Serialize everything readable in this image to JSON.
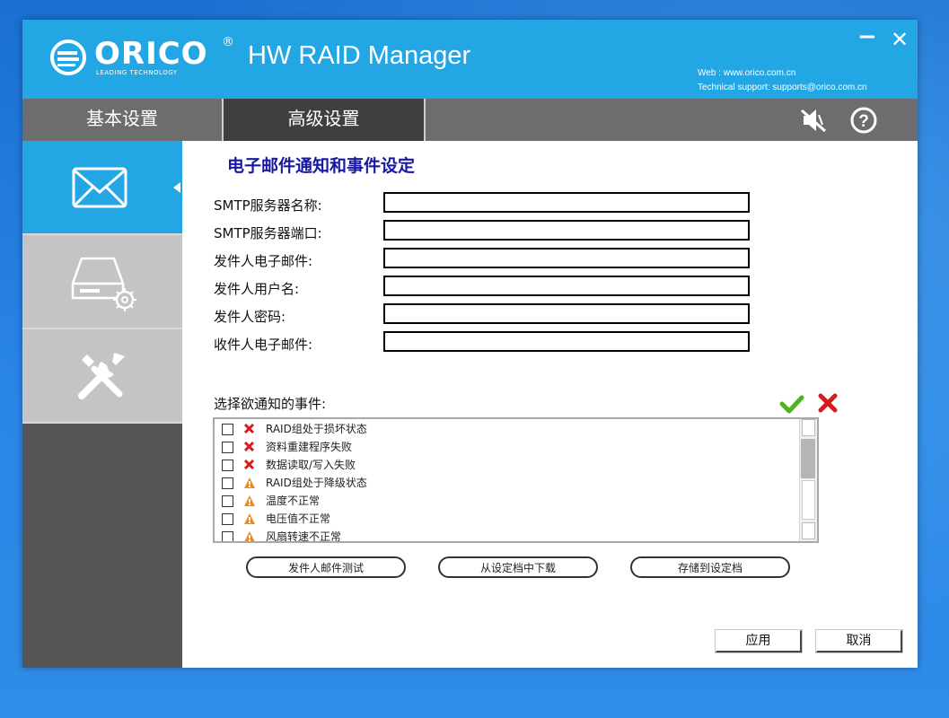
{
  "header": {
    "brand": "ORICO",
    "registered": "®",
    "tagline": "LEADING TECHNOLOGY",
    "app_title": "HW RAID Manager",
    "web": "Web : www.orico.com.cn",
    "support": "Technical support: supports@orico.com.cn",
    "minimize": "−",
    "close": "✕"
  },
  "tabs": [
    {
      "label": "基本设置"
    },
    {
      "label": "高级设置",
      "active": true
    }
  ],
  "sidebar": {
    "items": [
      {
        "icon": "mail-icon",
        "active": true
      },
      {
        "icon": "disk-settings-icon"
      },
      {
        "icon": "tools-icon"
      }
    ]
  },
  "main": {
    "title": "电子邮件通知和事件设定",
    "fields": [
      {
        "label": "SMTP服务器名称:",
        "value": ""
      },
      {
        "label": "SMTP服务器端口:",
        "value": ""
      },
      {
        "label": "发件人电子邮件:",
        "value": ""
      },
      {
        "label": "发件人用户名:",
        "value": ""
      },
      {
        "label": "发件人密码:",
        "value": ""
      },
      {
        "label": "收件人电子邮件:",
        "value": ""
      }
    ],
    "events_label": "选择欲通知的事件:",
    "events": [
      {
        "label": "RAID组处于损坏状态",
        "icon": "error-x-icon",
        "checked": false
      },
      {
        "label": "资料重建程序失败",
        "icon": "error-x-icon",
        "checked": false
      },
      {
        "label": "数据读取/写入失败",
        "icon": "error-x-icon",
        "checked": false
      },
      {
        "label": "RAID组处于降级状态",
        "icon": "warning-icon",
        "checked": false
      },
      {
        "label": "温度不正常",
        "icon": "warning-icon",
        "checked": false
      },
      {
        "label": "电压值不正常",
        "icon": "warning-icon",
        "checked": false
      },
      {
        "label": "风扇转速不正常",
        "icon": "warning-icon",
        "checked": false
      }
    ],
    "buttons": {
      "test": "发件人邮件测试",
      "load": "从设定档中下载",
      "save": "存储到设定档",
      "apply": "应用",
      "cancel": "取消"
    }
  },
  "colors": {
    "accent": "#22a6e4",
    "tabbar": "#6d6d6d",
    "active_tab": "#3f3f3f",
    "title_text": "#1818a0",
    "error": "#d61c1c",
    "warning": "#f08a1c",
    "check": "#4fb21f"
  }
}
